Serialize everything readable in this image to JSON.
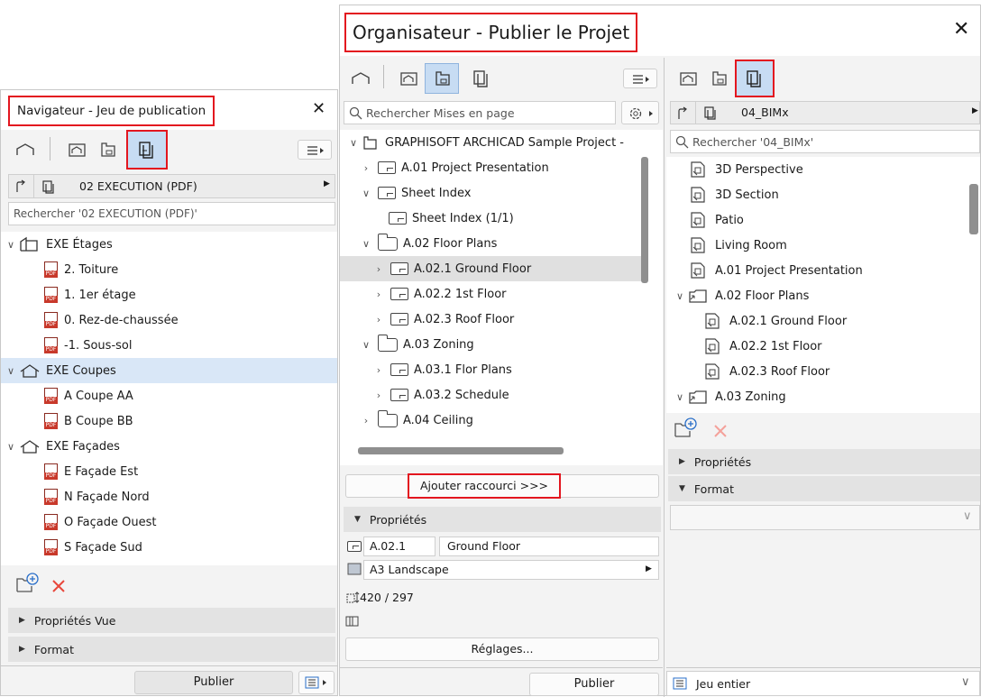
{
  "navigator": {
    "title": "Navigateur - Jeu de publication",
    "close": "✕",
    "set_name": "02 EXECUTION (PDF)",
    "search_placeholder": "Rechercher '02 EXECUTION (PDF)'",
    "tree": [
      {
        "label": "EXE Étages",
        "type": "group"
      },
      {
        "label": "2. Toiture",
        "type": "pdf"
      },
      {
        "label": "1. 1er étage",
        "type": "pdf"
      },
      {
        "label": "0. Rez-de-chaussée",
        "type": "pdf"
      },
      {
        "label": "-1. Sous-sol",
        "type": "pdf"
      },
      {
        "label": "EXE Coupes",
        "type": "group"
      },
      {
        "label": "A Coupe AA",
        "type": "pdf"
      },
      {
        "label": "B Coupe BB",
        "type": "pdf"
      },
      {
        "label": "EXE Façades",
        "type": "group"
      },
      {
        "label": "E Façade Est",
        "type": "pdf"
      },
      {
        "label": "N Façade Nord",
        "type": "pdf"
      },
      {
        "label": "O Façade Ouest",
        "type": "pdf"
      },
      {
        "label": "S Façade Sud",
        "type": "pdf"
      }
    ],
    "section_props": "Propriétés Vue",
    "section_format": "Format",
    "publish": "Publier"
  },
  "organizer": {
    "title": "Organisateur - Publier le Projet",
    "close": "✕",
    "left": {
      "search_placeholder": "Rechercher Mises en page",
      "tree": [
        {
          "label": "GRAPHISOFT ARCHICAD Sample Project -",
          "chev": "v",
          "icon": "book",
          "indent": 0
        },
        {
          "label": "A.01 Project Presentation",
          "chev": ">",
          "icon": "sheet",
          "indent": 1
        },
        {
          "label": "Sheet Index",
          "chev": "v",
          "icon": "sheet",
          "indent": 1
        },
        {
          "label": "Sheet Index (1/1)",
          "chev": "",
          "icon": "sheet",
          "indent": 2
        },
        {
          "label": "A.02 Floor Plans",
          "chev": "v",
          "icon": "folder",
          "indent": 1
        },
        {
          "label": "A.02.1 Ground Floor",
          "chev": ">",
          "icon": "sheet",
          "indent": 2
        },
        {
          "label": "A.02.2 1st Floor",
          "chev": ">",
          "icon": "sheet",
          "indent": 2
        },
        {
          "label": "A.02.3 Roof Floor",
          "chev": ">",
          "icon": "sheet",
          "indent": 2
        },
        {
          "label": "A.03 Zoning",
          "chev": "v",
          "icon": "folder",
          "indent": 1
        },
        {
          "label": "A.03.1 Flor Plans",
          "chev": ">",
          "icon": "sheet",
          "indent": 2
        },
        {
          "label": "A.03.2 Schedule",
          "chev": ">",
          "icon": "sheet",
          "indent": 2
        },
        {
          "label": "A.04 Ceiling",
          "chev": ">",
          "icon": "folder",
          "indent": 1
        }
      ],
      "add_shortcut": "Ajouter raccourci >>>",
      "properties": "Propriétés",
      "layout_id": "A.02.1",
      "layout_name": "Ground Floor",
      "master": "A3 Landscape",
      "size": "420 / 297",
      "settings": "Réglages...",
      "publish": "Publier"
    },
    "right": {
      "set_name": "04_BIMx",
      "search_placeholder": "Rechercher '04_BIMx'",
      "tree": [
        {
          "label": "3D Perspective",
          "type": "item",
          "indent": 1
        },
        {
          "label": "3D Section",
          "type": "item",
          "indent": 1
        },
        {
          "label": "Patio",
          "type": "item",
          "indent": 1
        },
        {
          "label": "Living Room",
          "type": "item",
          "indent": 1
        },
        {
          "label": "A.01 Project Presentation",
          "type": "item",
          "indent": 1
        },
        {
          "label": "A.02 Floor Plans",
          "type": "group",
          "indent": 0
        },
        {
          "label": "A.02.1 Ground Floor",
          "type": "item",
          "indent": 2
        },
        {
          "label": "A.02.2 1st Floor",
          "type": "item",
          "indent": 2
        },
        {
          "label": "A.02.3 Roof Floor",
          "type": "item",
          "indent": 2
        },
        {
          "label": "A.03 Zoning",
          "type": "group",
          "indent": 0
        }
      ],
      "properties": "Propriétés",
      "format": "Format",
      "scope": "Jeu entier"
    }
  },
  "colors": {
    "highlight": "#e3161f",
    "selection": "#d9e7f7",
    "delete": "#e8473b"
  }
}
